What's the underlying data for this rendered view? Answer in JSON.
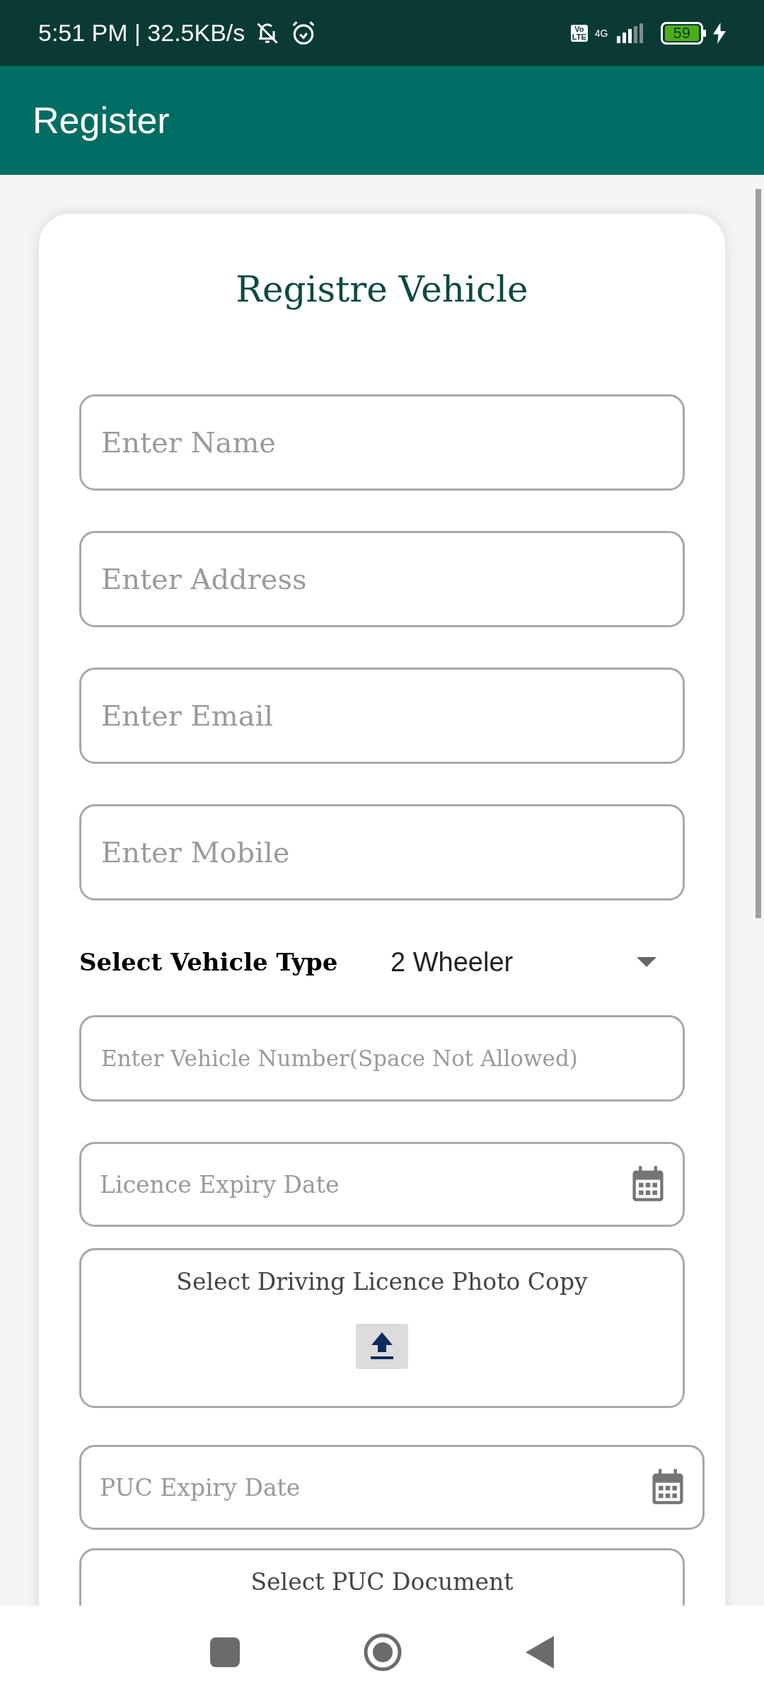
{
  "status_bar": {
    "time_speed": "5:51 PM | 32.5KB/s",
    "volte": [
      "Vo",
      "LTE"
    ],
    "network": "4G",
    "battery": "59"
  },
  "app_bar": {
    "title": "Register"
  },
  "form": {
    "title": "Registre Vehicle",
    "fields": [
      {
        "kind": "text",
        "placeholder": "Enter Name"
      },
      {
        "kind": "text",
        "placeholder": "Enter Address"
      },
      {
        "kind": "text",
        "placeholder": "Enter Email"
      },
      {
        "kind": "text",
        "placeholder": "Enter Mobile"
      },
      {
        "kind": "select",
        "label": "Select Vehicle Type",
        "value": "2 Wheeler"
      },
      {
        "kind": "small",
        "placeholder": "Enter Vehicle Number(Space Not Allowed)"
      },
      {
        "kind": "date",
        "placeholder": "Licence Expiry Date"
      },
      {
        "kind": "upload",
        "label": "Select Driving Licence Photo Copy",
        "icon": true
      },
      {
        "kind": "date_wide",
        "placeholder": "PUC Expiry Date"
      },
      {
        "kind": "upload",
        "label": "Select PUC Document"
      }
    ]
  }
}
